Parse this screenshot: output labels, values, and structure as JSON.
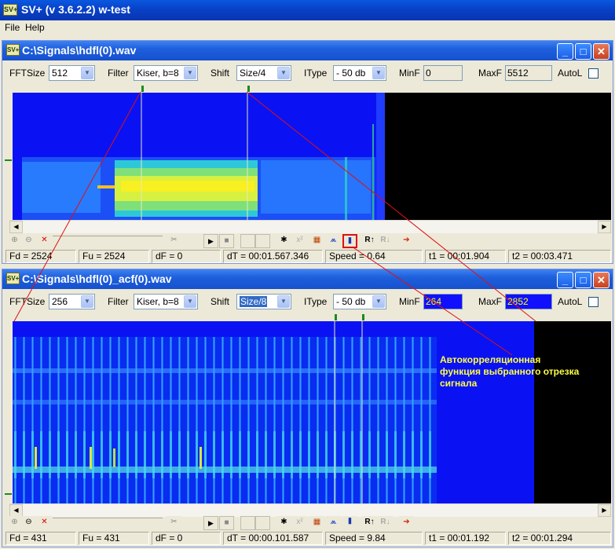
{
  "app": {
    "logo": "SV+",
    "title": "SV+  (v 3.6.2.2) w-test"
  },
  "menu": [
    {
      "label": "File"
    },
    {
      "label": "Help"
    }
  ],
  "windows": [
    {
      "title": "C:\\Signals\\hdfl(0).wav",
      "controls": {
        "fftsize_label": "FFTSize",
        "fftsize_value": "512",
        "filter_label": "Filter",
        "filter_value": "Kiser, b=8",
        "shift_label": "Shift",
        "shift_value": "Size/4",
        "itype_label": "IType",
        "itype_value": "- 50 db",
        "minf_label": "MinF",
        "minf_value": "0",
        "maxf_label": "MaxF",
        "maxf_value": "5512",
        "autol_label": "AutoL"
      },
      "status": {
        "fd": "Fd = 2524",
        "fu": "Fu = 2524",
        "df": "dF = 0",
        "dt": "dT = 00:01.567.346",
        "speed": "Speed = 0.64",
        "t1": "t1 = 00:01.904",
        "t2": "t2 = 00:03.471"
      }
    },
    {
      "title": "C:\\Signals\\hdfl(0)_acf(0).wav",
      "controls": {
        "fftsize_label": "FFTSize",
        "fftsize_value": "256",
        "filter_label": "Filter",
        "filter_value": "Kiser, b=8",
        "shift_label": "Shift",
        "shift_value": "Size/8",
        "itype_label": "IType",
        "itype_value": "- 50 db",
        "minf_label": "MinF",
        "minf_value": "264",
        "maxf_label": "MaxF",
        "maxf_value": "2852",
        "autol_label": "AutoL"
      },
      "status": {
        "fd": "Fd = 431",
        "fu": "Fu = 431",
        "df": "dF = 0",
        "dt": "dT = 00:00.101.587",
        "speed": "Speed = 9.84",
        "t1": "t1 = 00:01.192",
        "t2": "t2 = 00:01.294"
      }
    }
  ],
  "annotation": {
    "lines": [
      "Автокорреляционная",
      "функция выбранного отрезка",
      "сигнала"
    ]
  },
  "colors": {
    "spectrogram_bg": "#0a12f4",
    "annotation_text": "#ffff40",
    "arrow_line": "#e01010",
    "highlight_box": "#e01010"
  },
  "icons": {
    "window_controls": [
      "minimize-icon",
      "maximize-icon",
      "close-icon"
    ],
    "toolbar": [
      "zoom-in-icon",
      "zoom-out-icon",
      "zoom-reset-icon",
      "cut-icon",
      "play-icon",
      "stop-icon",
      "mark-left-icon",
      "mark-right-icon",
      "asterisk-icon",
      "x-squared-icon",
      "palette-icon",
      "spectrum-icon",
      "acf-icon",
      "rt-up-icon",
      "rt-down-icon",
      "export-icon"
    ]
  }
}
